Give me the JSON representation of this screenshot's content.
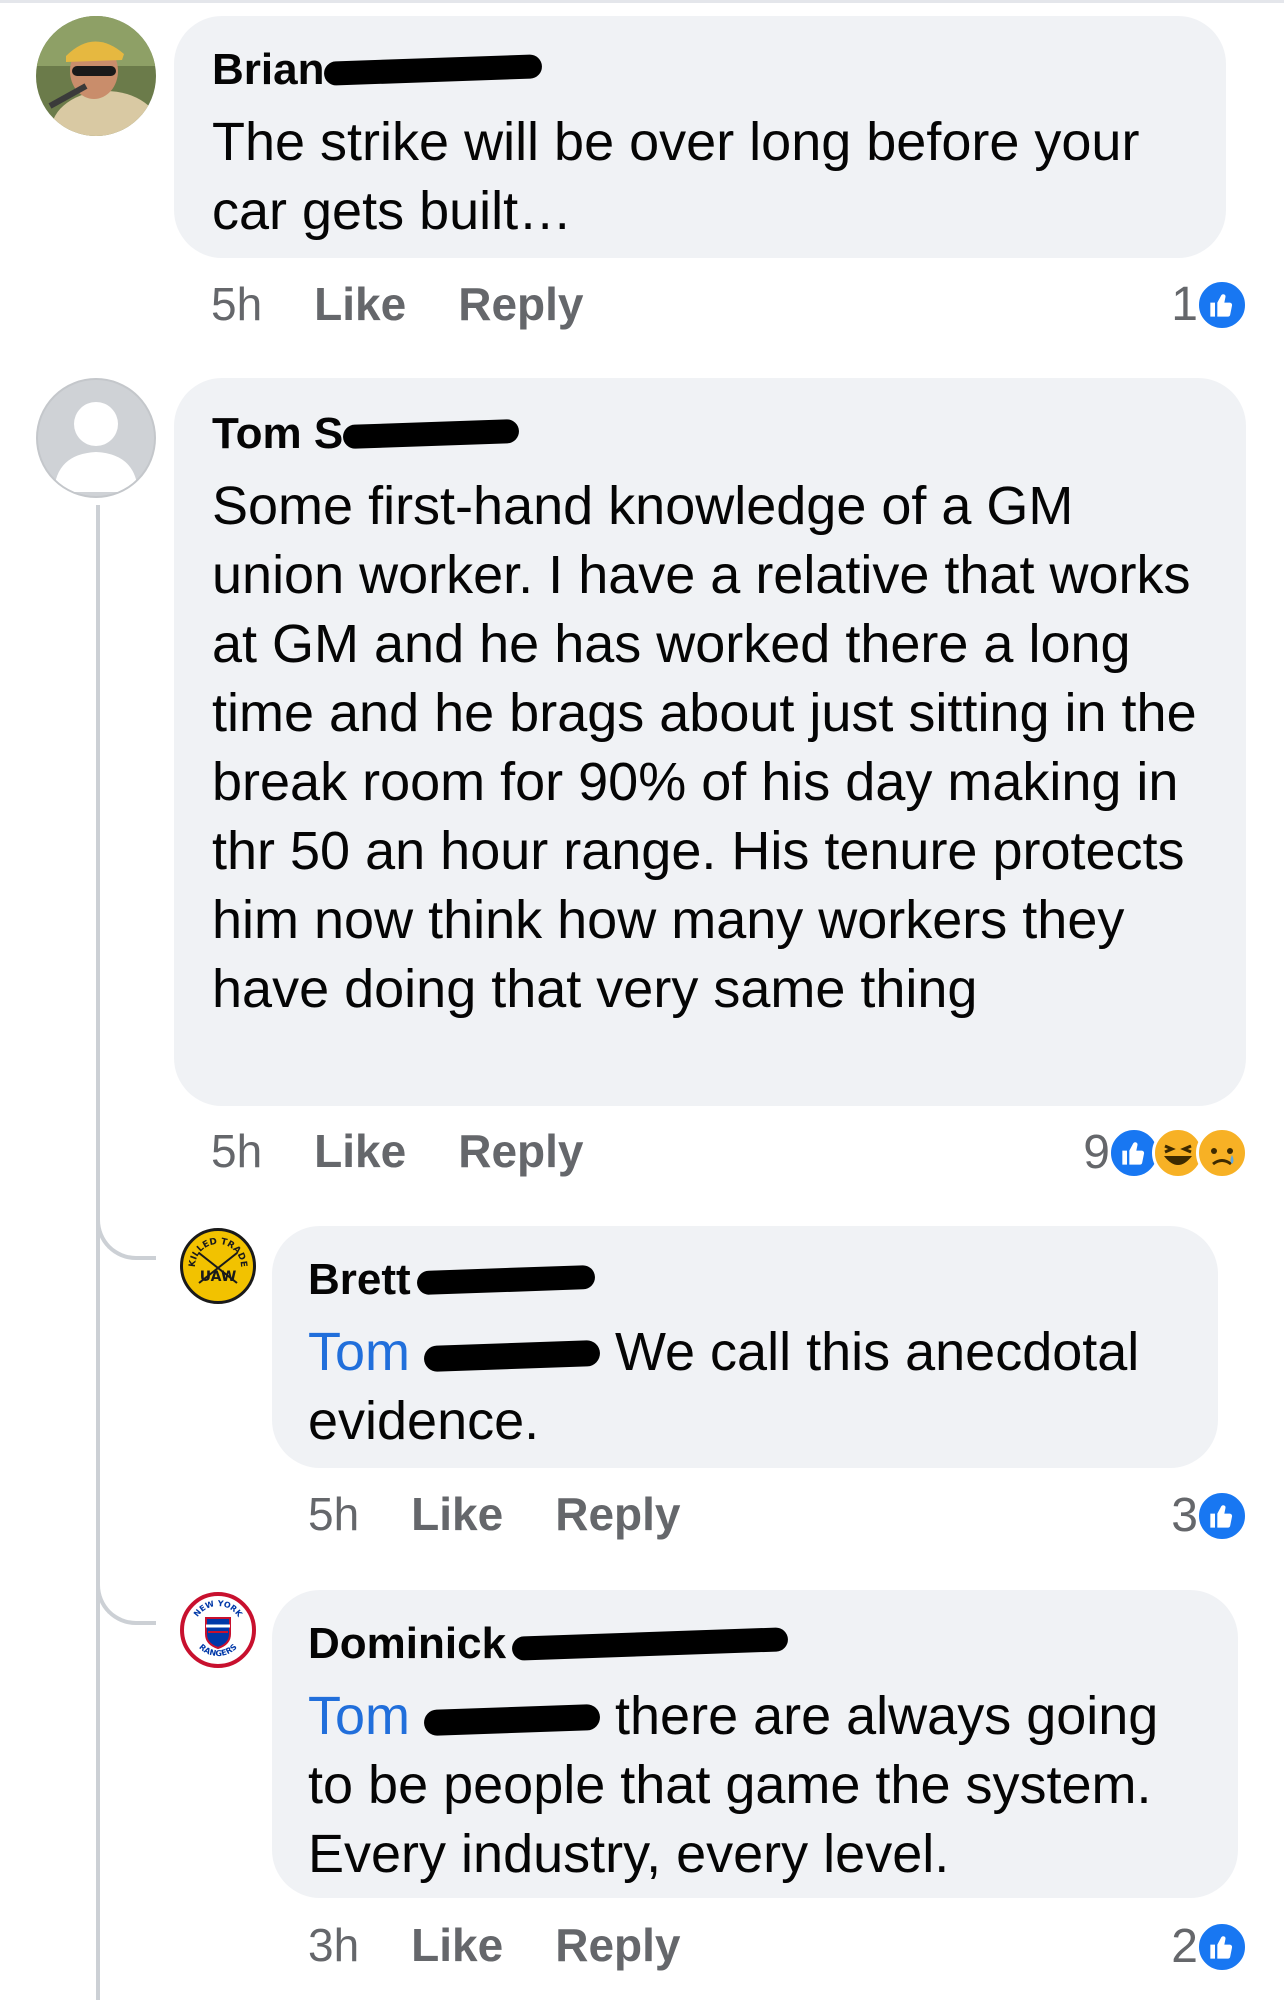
{
  "comments": [
    {
      "author": "Brian",
      "text": "The strike will be over long before your car gets built…",
      "time": "5h",
      "like_label": "Like",
      "reply_label": "Reply",
      "reaction_count": "1",
      "reactions": [
        "like"
      ]
    },
    {
      "author": "Tom S",
      "text": "Some first-hand knowledge of a GM union worker. I have a relative that works at GM and he has worked there a long time and he brags about just sitting in the break room for 90% of his day making in thr 50 an hour range. His tenure protects him now think how many workers they have doing that very same thing",
      "time": "5h",
      "like_label": "Like",
      "reply_label": "Reply",
      "reaction_count": "9",
      "reactions": [
        "like",
        "haha",
        "sad"
      ]
    }
  ],
  "replies": [
    {
      "author": "Brett",
      "mention": "Tom",
      "text": " We call this anecdotal evidence.",
      "time": "5h",
      "like_label": "Like",
      "reply_label": "Reply",
      "reaction_count": "3",
      "reactions": [
        "like"
      ],
      "avatar_badge": "UAW",
      "avatar_text_top": "SKILLED TRADES"
    },
    {
      "author": "Dominick",
      "mention": "Tom",
      "text": " there are always going to be people that game the system. Every industry, every level.",
      "time": "3h",
      "like_label": "Like",
      "reply_label": "Reply",
      "reaction_count": "2",
      "reactions": [
        "like"
      ],
      "avatar_text_top": "NEW YORK",
      "avatar_text_bottom": "RANGERS"
    }
  ],
  "colors": {
    "bubble": "#f0f2f5",
    "mention": "#216fdb",
    "meta": "#65676b",
    "like_blue": "#1877f2",
    "emoji_yellow": "#f7b125"
  }
}
